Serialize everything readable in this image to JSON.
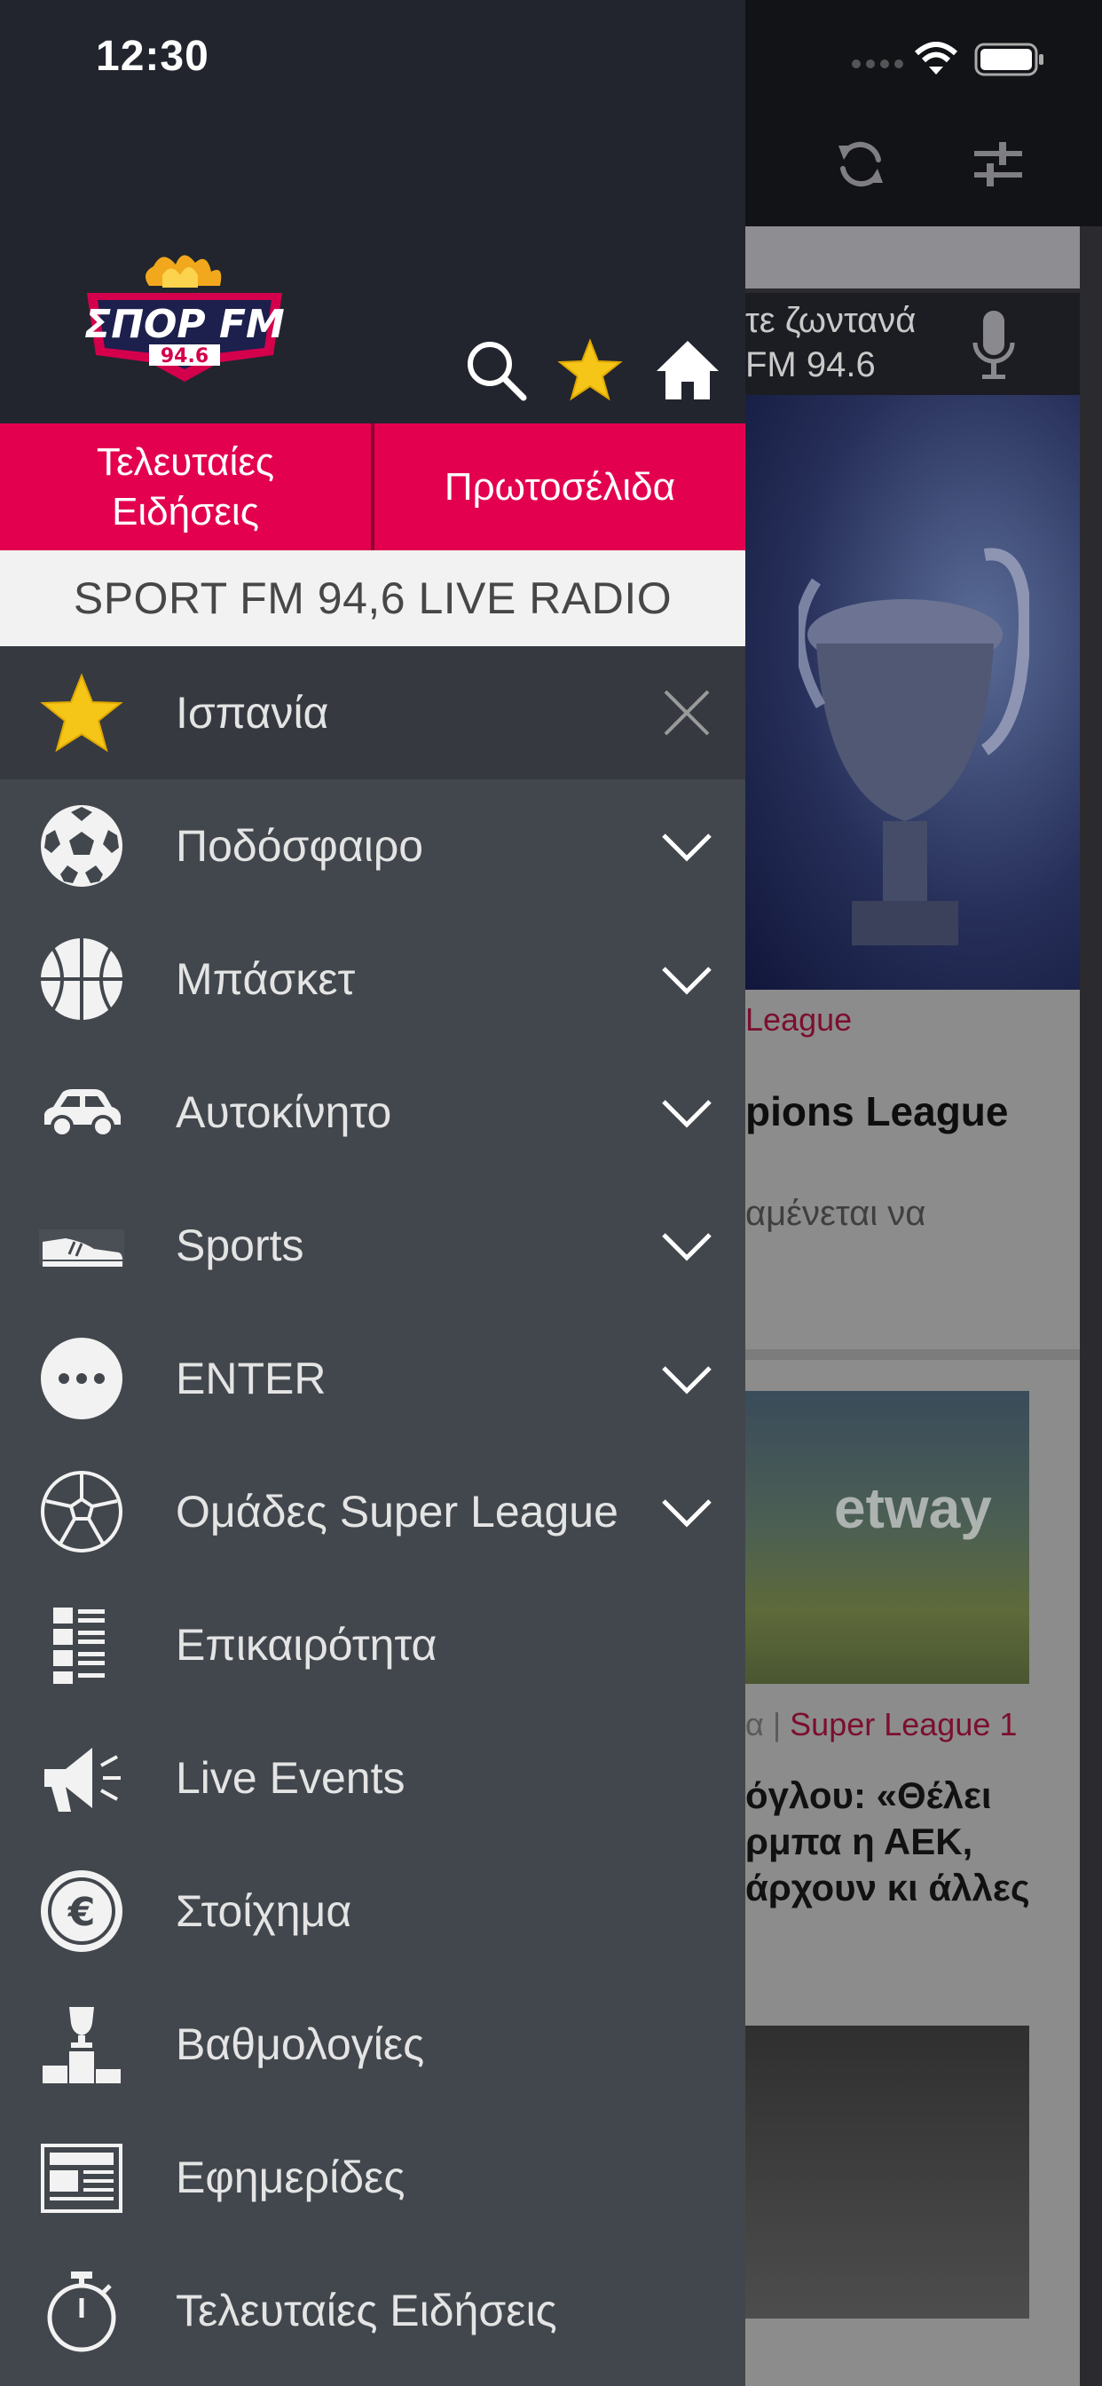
{
  "status_bar": {
    "time": "12:30"
  },
  "drawer": {
    "tabs": [
      {
        "label": "Τελευταίες\nΕιδήσεις"
      },
      {
        "label": "Πρωτοσέλιδα"
      }
    ],
    "live_radio_label": "SPORT FM 94,6 LIVE RADIO",
    "header_icons": [
      "search-icon",
      "star-icon",
      "home-icon"
    ],
    "accent_color": "#e3004f",
    "menu": [
      {
        "label": "Ισπανία",
        "icon": "star-icon",
        "action": "close-icon"
      },
      {
        "label": "Ποδόσφαιρο",
        "icon": "soccer-ball-icon",
        "action": "chevron-down-icon"
      },
      {
        "label": "Μπάσκετ",
        "icon": "basketball-icon",
        "action": "chevron-down-icon"
      },
      {
        "label": "Αυτοκίνητο",
        "icon": "car-icon",
        "action": "chevron-down-icon"
      },
      {
        "label": "Sports",
        "icon": "sneaker-icon",
        "action": "chevron-down-icon"
      },
      {
        "label": "ENTER",
        "icon": "more-dots-icon",
        "action": "chevron-down-icon"
      },
      {
        "label": "Ομάδες Super League",
        "icon": "ball-outline-icon",
        "action": "chevron-down-icon"
      },
      {
        "label": "Επικαιρότητα",
        "icon": "news-list-icon",
        "action": ""
      },
      {
        "label": "Live Events",
        "icon": "megaphone-icon",
        "action": ""
      },
      {
        "label": "Στοίχημα",
        "icon": "euro-coin-icon",
        "action": ""
      },
      {
        "label": "Βαθμολογίες",
        "icon": "podium-trophy-icon",
        "action": ""
      },
      {
        "label": "Εφημερίδες",
        "icon": "newspaper-icon",
        "action": ""
      },
      {
        "label": "Τελευταίες Ειδήσεις",
        "icon": "stopwatch-icon",
        "action": ""
      }
    ]
  },
  "background": {
    "live_text_line1": "τε ζωντανά",
    "live_text_line2": "FM 94.6",
    "card1_category": "League",
    "card1_title": "pions League",
    "card1_desc": "αμένεται να",
    "card2_category_prefix": "α",
    "card2_category_separator": " | ",
    "card2_category": "Super League 1",
    "card2_headline_1": "όγλου: «Θέλει",
    "card2_headline_2": "ρμπα η ΑΕΚ,",
    "card2_headline_3": "άρχουν κι άλλες",
    "photo1_word": "etway"
  }
}
